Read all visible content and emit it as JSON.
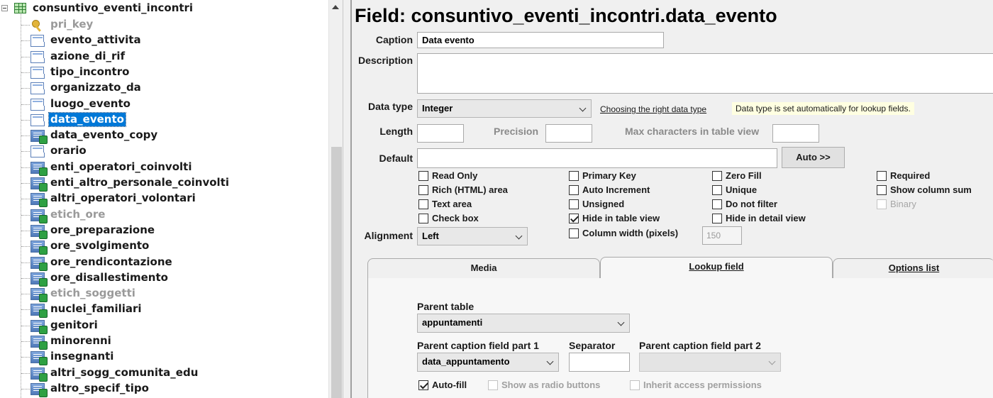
{
  "tree": {
    "root_label": "consuntivo_eventi_incontri",
    "items": [
      {
        "label": "pri_key",
        "icon": "key-icon",
        "grey": true
      },
      {
        "label": "evento_attivita",
        "icon": "field-icon"
      },
      {
        "label": "azione_di_rif",
        "icon": "field-icon"
      },
      {
        "label": "tipo_incontro",
        "icon": "field-icon"
      },
      {
        "label": "organizzato_da",
        "icon": "field-icon"
      },
      {
        "label": "luogo_evento",
        "icon": "field-icon"
      },
      {
        "label": "data_evento",
        "icon": "field-icon",
        "selected": true
      },
      {
        "label": "data_evento_copy",
        "icon": "lookup-field-icon"
      },
      {
        "label": "orario",
        "icon": "field-icon"
      },
      {
        "label": "enti_operatori_coinvolti",
        "icon": "lookup-field-icon"
      },
      {
        "label": "enti_altro_personale_coinvolti",
        "icon": "lookup-field-icon"
      },
      {
        "label": "altri_operatori_volontari",
        "icon": "lookup-field-icon"
      },
      {
        "label": "etich_ore",
        "icon": "lookup-field-icon",
        "grey": true
      },
      {
        "label": "ore_preparazione",
        "icon": "lookup-field-icon"
      },
      {
        "label": "ore_svolgimento",
        "icon": "lookup-field-icon"
      },
      {
        "label": "ore_rendicontazione",
        "icon": "lookup-field-icon"
      },
      {
        "label": "ore_disallestimento",
        "icon": "lookup-field-icon"
      },
      {
        "label": "etich_soggetti",
        "icon": "lookup-field-icon",
        "grey": true
      },
      {
        "label": "nuclei_familiari",
        "icon": "lookup-field-icon"
      },
      {
        "label": "genitori",
        "icon": "lookup-field-icon"
      },
      {
        "label": "minorenni",
        "icon": "lookup-field-icon"
      },
      {
        "label": "insegnanti",
        "icon": "lookup-field-icon"
      },
      {
        "label": "altri_sogg_comunita_edu",
        "icon": "lookup-field-icon"
      },
      {
        "label": "altro_specif_tipo",
        "icon": "lookup-field-icon"
      }
    ]
  },
  "field": {
    "title": "Field: consuntivo_eventi_incontri.data_evento",
    "caption_label": "Caption",
    "caption_value": "Data evento",
    "description_label": "Description",
    "description_value": "",
    "data_type_label": "Data type",
    "data_type_value": "Integer",
    "data_type_link": "Choosing the right data type",
    "data_type_hint": "Data type is set automatically for lookup fields.",
    "length_label": "Length",
    "length_value": "",
    "precision_label": "Precision",
    "precision_value": "",
    "max_chars_label": "Max characters in table view",
    "max_chars_value": "",
    "default_label": "Default",
    "default_value": "",
    "auto_button": "Auto >>",
    "alignment_label": "Alignment",
    "alignment_value": "Left",
    "column_width_value": "150"
  },
  "checkboxes": {
    "read_only": {
      "label": "Read Only",
      "checked": false
    },
    "rich_html": {
      "label": "Rich (HTML) area",
      "checked": false
    },
    "text_area": {
      "label": "Text area",
      "checked": false
    },
    "check_box": {
      "label": "Check box",
      "checked": false
    },
    "primary_key": {
      "label": "Primary Key",
      "checked": false
    },
    "auto_increment": {
      "label": "Auto Increment",
      "checked": false
    },
    "unsigned": {
      "label": "Unsigned",
      "checked": false
    },
    "hide_table_view": {
      "label": "Hide in table view",
      "checked": true
    },
    "column_width": {
      "label": "Column width (pixels)",
      "checked": false
    },
    "zero_fill": {
      "label": "Zero Fill",
      "checked": false
    },
    "unique": {
      "label": "Unique",
      "checked": false
    },
    "do_not_filter": {
      "label": "Do not filter",
      "checked": false
    },
    "hide_detail_view": {
      "label": "Hide in detail view",
      "checked": false
    },
    "required": {
      "label": "Required",
      "checked": false
    },
    "show_column_sum": {
      "label": "Show column sum",
      "checked": false
    },
    "binary": {
      "label": "Binary",
      "checked": false
    }
  },
  "tabs": {
    "media": "Media",
    "lookup": "Lookup field",
    "options": "Options list"
  },
  "lookup": {
    "parent_table_label": "Parent table",
    "parent_table_value": "appuntamenti",
    "caption_part1_label": "Parent caption field part 1",
    "caption_part1_value": "data_appuntamento",
    "separator_label": "Separator",
    "separator_value": "",
    "caption_part2_label": "Parent caption field part 2",
    "caption_part2_value": "",
    "auto_fill": {
      "label": "Auto-fill",
      "checked": true
    },
    "radio_buttons": {
      "label": "Show as radio buttons",
      "checked": false
    },
    "inherit_access": {
      "label": "Inherit access permissions",
      "checked": false
    }
  },
  "colors": {
    "selection": "#0078d7",
    "hint_background": "#ffffe1"
  }
}
